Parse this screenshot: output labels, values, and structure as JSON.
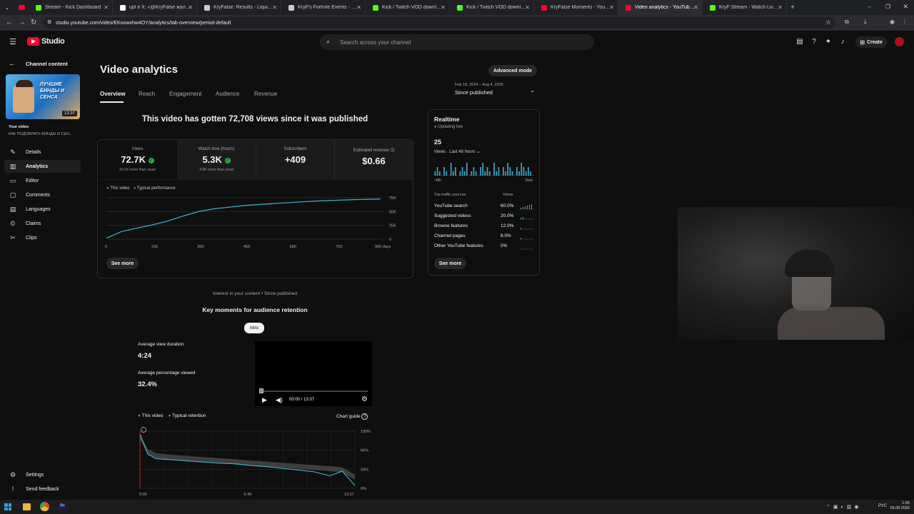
{
  "browser": {
    "tabs": [
      {
        "label": "Stream - Kick Dashboard",
        "favicon": "kick-icon",
        "color": "#53fc18"
      },
      {
        "label": "upl в X: «@KryFalse жаль» / X",
        "favicon": "x-icon",
        "color": "#ffffff"
      },
      {
        "label": "KryFalse: Results - Liquipedia Fo",
        "favicon": "liquipedia-icon",
        "color": "#cccccc"
      },
      {
        "label": "KryF's Fortnite Events - Fortnite",
        "favicon": "fortnite-icon",
        "color": "#cccccc"
      },
      {
        "label": "Kick / Twitch VOD downloader",
        "favicon": "download-icon",
        "color": "#53fc18"
      },
      {
        "label": "Kick / Twitch VOD downloader",
        "favicon": "download-icon",
        "color": "#53fc18"
      },
      {
        "label": "KryFalse Moments - YouTube",
        "favicon": "youtube-icon",
        "color": "#ff0033"
      },
      {
        "label": "Video analytics - YouTube Studio",
        "favicon": "youtube-studio-icon",
        "color": "#ff0033"
      },
      {
        "label": "KryF Stream - Watch Live on Kick",
        "favicon": "kick-icon",
        "color": "#53fc18"
      }
    ],
    "url": "studio.youtube.com/video/EKoowxhw4OY/analytics/tab-overview/period-default"
  },
  "header": {
    "logo": "Studio",
    "search_placeholder": "Search across your channel",
    "create_label": "Create"
  },
  "sidebar": {
    "back_label": "Channel content",
    "thumbnail_text": "ЛУЧШИЕ БИНДЫ И СЕНСА",
    "thumbnail_duration": "13:37",
    "your_video_label": "Your video",
    "video_title": "КАК ПОДОБРАТЬ БИНДЫ И СЕН...",
    "items": [
      {
        "label": "Details",
        "icon": "pencil-icon"
      },
      {
        "label": "Analytics",
        "icon": "analytics-icon"
      },
      {
        "label": "Editor",
        "icon": "editor-icon"
      },
      {
        "label": "Comments",
        "icon": "comments-icon"
      },
      {
        "label": "Languages",
        "icon": "languages-icon"
      },
      {
        "label": "Claims",
        "icon": "claims-icon"
      },
      {
        "label": "Clips",
        "icon": "scissors-icon"
      }
    ],
    "settings_label": "Settings",
    "feedback_label": "Send feedback"
  },
  "page": {
    "title": "Video analytics",
    "advanced_mode": "Advanced mode",
    "tabs": [
      "Overview",
      "Reach",
      "Engagement",
      "Audience",
      "Revenue"
    ],
    "date_range": "Feb 18, 2024 – Aug 4, 2026",
    "date_label": "Since published",
    "headline": "This video has gotten 72,708 views since it was published"
  },
  "metrics": [
    {
      "label": "Views",
      "value": "72.7K",
      "sub": "65.6K more than usual",
      "check": true
    },
    {
      "label": "Watch time (hours)",
      "value": "5.3K",
      "sub": "4.8K more than usual",
      "check": true
    },
    {
      "label": "Subscribers",
      "value": "+409",
      "sub": "",
      "check": false
    },
    {
      "label": "Estimated revenue",
      "value": "$0.66",
      "sub": "",
      "check": false
    }
  ],
  "views_chart": {
    "legend_this": "This video",
    "legend_typical": "Typical performance",
    "y_ticks": [
      "75K",
      "50K",
      "25K",
      "0"
    ],
    "x_ticks": [
      "0",
      "150",
      "300",
      "450",
      "600",
      "750",
      "900 days"
    ],
    "see_more": "See more",
    "chart_data": {
      "type": "line",
      "x": [
        0,
        50,
        100,
        150,
        200,
        250,
        300,
        350,
        400,
        450,
        500,
        550,
        600,
        650,
        700,
        750,
        800,
        850,
        890
      ],
      "series": [
        {
          "name": "This video",
          "values": [
            2000,
            14000,
            20000,
            26000,
            33000,
            42000,
            50000,
            55000,
            58000,
            61000,
            63000,
            64800,
            66500,
            68000,
            69500,
            70500,
            71500,
            72200,
            72708
          ]
        }
      ],
      "ylim": [
        0,
        75000
      ]
    }
  },
  "realtime": {
    "title": "Realtime",
    "updating": "Updating live",
    "count": "25",
    "views_label": "Views · Last 48 hours",
    "bar_start": "-48h",
    "bar_end": "Now",
    "bars": [
      1,
      2,
      1,
      0,
      2,
      1,
      0,
      3,
      1,
      2,
      0,
      1,
      2,
      1,
      3,
      0,
      1,
      2,
      1,
      0,
      2,
      3,
      1,
      2,
      1,
      0,
      3,
      1,
      2,
      0,
      2,
      1,
      3,
      2,
      1,
      0,
      2,
      1,
      3,
      2,
      1,
      2,
      1,
      0
    ],
    "sources_title": "Top traffic sources",
    "sources_col": "Views",
    "sources": [
      {
        "label": "YouTube search",
        "pct": "60.0%"
      },
      {
        "label": "Suggested videos",
        "pct": "20.0%"
      },
      {
        "label": "Browse features",
        "pct": "12.0%"
      },
      {
        "label": "Channel pages",
        "pct": "8.0%"
      },
      {
        "label": "Other YouTube features",
        "pct": "0%"
      }
    ],
    "see_more": "See more"
  },
  "retention": {
    "interest_label": "Interest in your content • Since published",
    "title": "Key moments for audience retention",
    "intro_chip": "Intro",
    "avg_duration_label": "Average view duration",
    "avg_duration": "4:24",
    "avg_pct_label": "Average percentage viewed",
    "avg_pct": "32.4%",
    "player_time": "00:00 / 13:37",
    "legend_this": "This video",
    "legend_typical": "Typical retention",
    "chart_guide": "Chart guide",
    "y_ticks": [
      "100%",
      "66%",
      "33%",
      "0%"
    ],
    "x_start": "0:00",
    "x_mid": "6:49",
    "x_end": "13:37",
    "chart_data": {
      "type": "line",
      "x": [
        0,
        0.5,
        1,
        2,
        3,
        4,
        5,
        6,
        7,
        8,
        9,
        10,
        11,
        12,
        12.8,
        13.6
      ],
      "series": [
        {
          "name": "This video",
          "values": [
            95,
            60,
            52,
            50,
            48,
            46,
            44,
            43,
            40,
            38,
            35,
            32,
            29,
            22,
            30,
            5
          ]
        },
        {
          "name": "Typical retention",
          "values": [
            90,
            65,
            58,
            55,
            53,
            51,
            49,
            47,
            45,
            43,
            41,
            39,
            37,
            35,
            33,
            20
          ]
        }
      ],
      "ylim": [
        0,
        100
      ]
    }
  },
  "taskbar": {
    "lang": "РУС",
    "time": "1:05",
    "date": "05.08.2026"
  }
}
